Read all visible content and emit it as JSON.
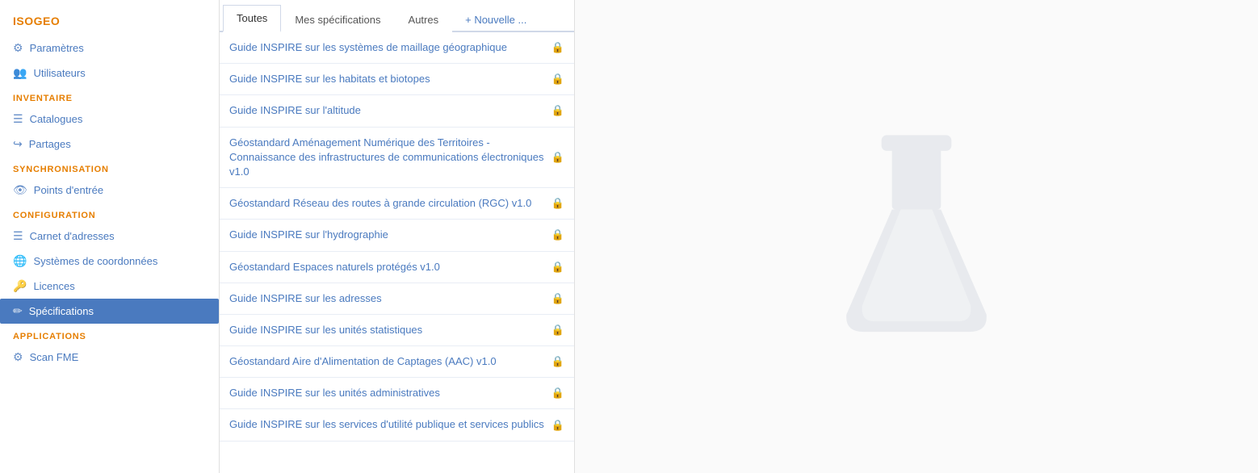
{
  "sidebar": {
    "brand": "ISOGEO",
    "sections": [
      {
        "label": null,
        "items": [
          {
            "id": "parametres",
            "icon": "⚙",
            "label": "Paramètres",
            "active": false
          },
          {
            "id": "utilisateurs",
            "icon": "👥",
            "label": "Utilisateurs",
            "active": false
          }
        ]
      },
      {
        "label": "INVENTAIRE",
        "items": [
          {
            "id": "catalogues",
            "icon": "☰",
            "label": "Catalogues",
            "active": false
          },
          {
            "id": "partages",
            "icon": "↪",
            "label": "Partages",
            "active": false
          }
        ]
      },
      {
        "label": "SYNCHRONISATION",
        "items": [
          {
            "id": "points-entree",
            "icon": "👁",
            "label": "Points d'entrée",
            "active": false
          }
        ]
      },
      {
        "label": "CONFIGURATION",
        "items": [
          {
            "id": "carnet-adresses",
            "icon": "☰",
            "label": "Carnet d'adresses",
            "active": false
          },
          {
            "id": "systemes-coordonnees",
            "icon": "🌐",
            "label": "Systèmes de coordonnées",
            "active": false
          },
          {
            "id": "licences",
            "icon": "🔑",
            "label": "Licences",
            "active": false
          },
          {
            "id": "specifications",
            "icon": "✏",
            "label": "Spécifications",
            "active": true
          }
        ]
      },
      {
        "label": "APPLICATIONS",
        "items": [
          {
            "id": "scan-fme",
            "icon": "⚙",
            "label": "Scan FME",
            "active": false
          }
        ]
      }
    ]
  },
  "tabs": {
    "items": [
      {
        "id": "toutes",
        "label": "Toutes",
        "active": true
      },
      {
        "id": "mes-specifications",
        "label": "Mes spécifications",
        "active": false
      },
      {
        "id": "autres",
        "label": "Autres",
        "active": false
      }
    ],
    "new_label": "+ Nouvelle ..."
  },
  "specifications": [
    {
      "id": 1,
      "title": "Guide INSPIRE sur les systèmes de maillage géographique",
      "locked": true
    },
    {
      "id": 2,
      "title": "Guide INSPIRE sur les habitats et biotopes",
      "locked": true
    },
    {
      "id": 3,
      "title": "Guide INSPIRE sur l'altitude",
      "locked": true
    },
    {
      "id": 4,
      "title": "Géostandard Aménagement Numérique des Territoires - Connaissance des infrastructures de communications électroniques v1.0",
      "locked": true
    },
    {
      "id": 5,
      "title": "Géostandard Réseau des routes à grande circulation (RGC) v1.0",
      "locked": true
    },
    {
      "id": 6,
      "title": "Guide INSPIRE sur l'hydrographie",
      "locked": true
    },
    {
      "id": 7,
      "title": "Géostandard Espaces naturels protégés v1.0",
      "locked": true
    },
    {
      "id": 8,
      "title": "Guide INSPIRE sur les adresses",
      "locked": true
    },
    {
      "id": 9,
      "title": "Guide INSPIRE sur les unités statistiques",
      "locked": true
    },
    {
      "id": 10,
      "title": "Géostandard Aire d'Alimentation de Captages (AAC) v1.0",
      "locked": true
    },
    {
      "id": 11,
      "title": "Guide INSPIRE sur les unités administratives",
      "locked": true
    },
    {
      "id": 12,
      "title": "Guide INSPIRE sur les services d'utilité publique et services publics",
      "locked": true
    }
  ]
}
